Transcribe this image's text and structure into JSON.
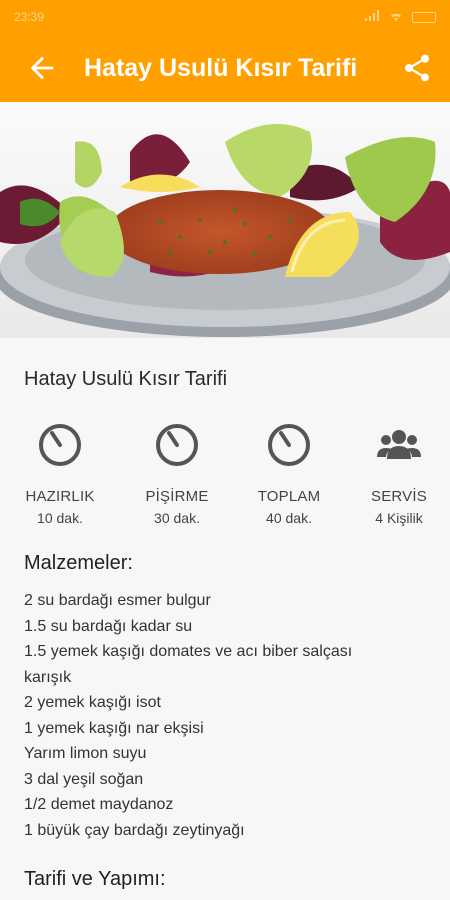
{
  "status_bar": {
    "time": "23:39"
  },
  "toolbar": {
    "title": "Hatay Usulü Kısır Tarifi",
    "back_icon": "arrow-back-icon",
    "share_icon": "share-icon",
    "color": "#ffa000"
  },
  "hero": {
    "image": "kısır salad plate photo"
  },
  "recipe": {
    "title": "Hatay Usulü Kısır Tarifi",
    "stats": [
      {
        "icon": "timer-icon",
        "label": "HAZIRLIK",
        "value": "10 dak."
      },
      {
        "icon": "timer-icon",
        "label": "PİŞİRME",
        "value": "30 dak."
      },
      {
        "icon": "timer-icon",
        "label": "TOPLAM",
        "value": "40 dak."
      },
      {
        "icon": "people-icon",
        "label": "SERVİS",
        "value": "4 Kişilik"
      }
    ],
    "ingredients_heading": "Malzemeler:",
    "ingredients": [
      "2 su bardağı esmer bulgur",
      "1.5 su bardağı kadar su",
      "1.5 yemek kaşığı domates ve acı biber salçası",
      "karışık",
      "2 yemek kaşığı isot",
      "1 yemek kaşığı nar ekşisi",
      "Yarım limon suyu",
      "3 dal yeşil soğan",
      "1/2 demet maydanoz",
      "1 büyük çay bardağı zeytinyağı"
    ],
    "method_heading": "Tarifi ve Yapımı:"
  }
}
